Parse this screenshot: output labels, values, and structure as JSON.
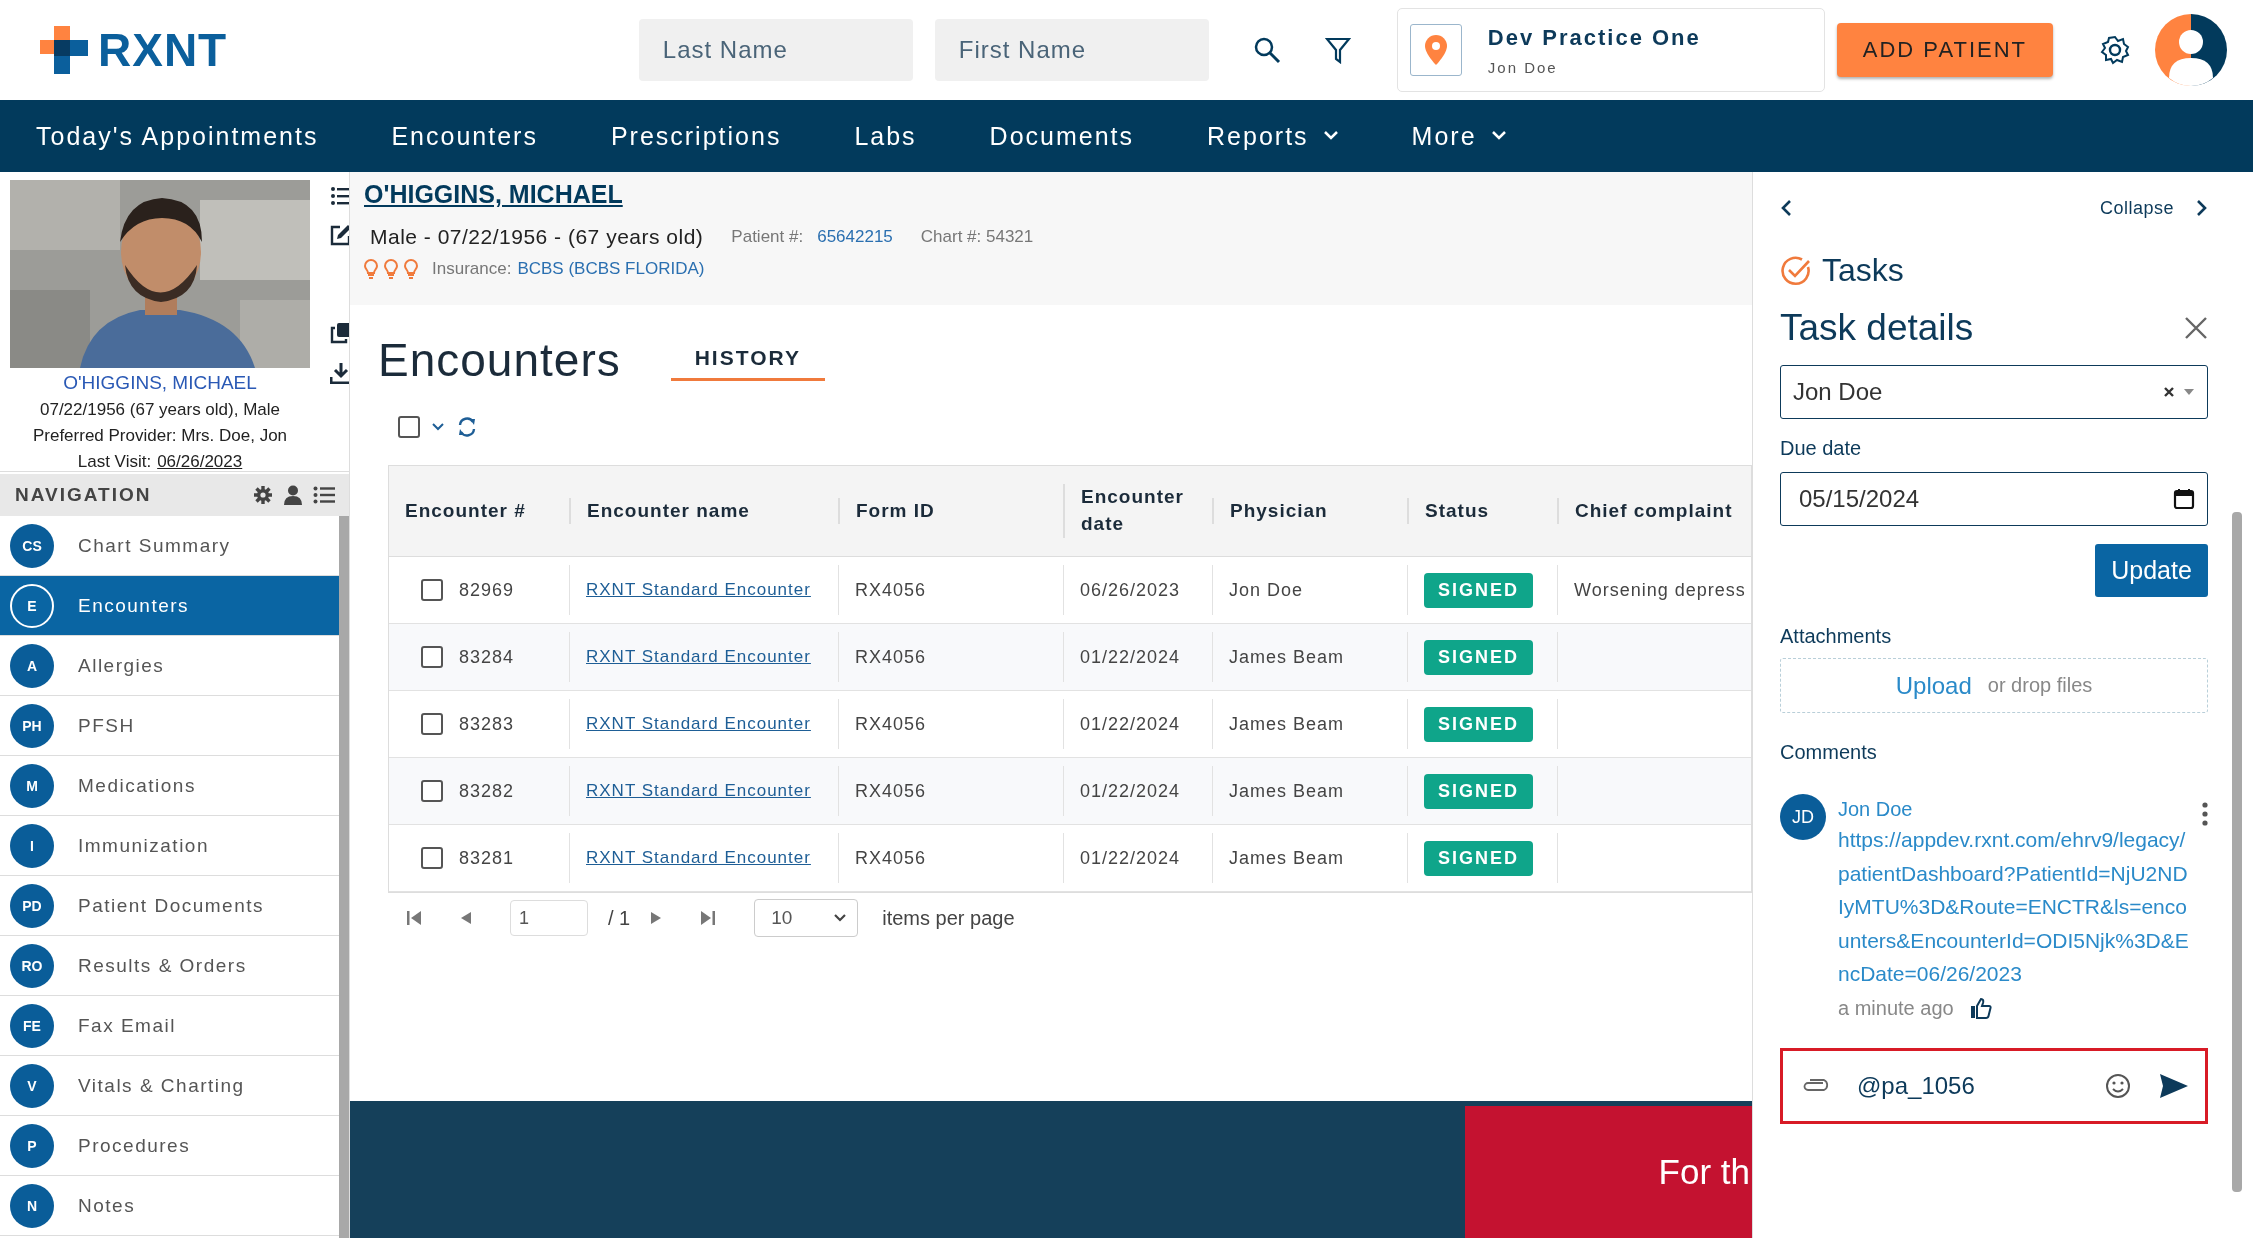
{
  "logo": {
    "text": "RXNT"
  },
  "search": {
    "last_name_placeholder": "Last Name",
    "first_name_placeholder": "First Name"
  },
  "practice": {
    "name": "Dev Practice One",
    "user": "Jon Doe"
  },
  "add_patient_button": "ADD PATIENT",
  "main_nav": [
    {
      "label": "Today's Appointments",
      "dropdown": false
    },
    {
      "label": "Encounters",
      "dropdown": false
    },
    {
      "label": "Prescriptions",
      "dropdown": false
    },
    {
      "label": "Labs",
      "dropdown": false
    },
    {
      "label": "Documents",
      "dropdown": false
    },
    {
      "label": "Reports",
      "dropdown": true
    },
    {
      "label": "More",
      "dropdown": true
    }
  ],
  "patient_card": {
    "name": "O'HIGGINS, MICHAEL",
    "details": "07/22/1956 (67 years old), Male",
    "provider": "Preferred Provider: Mrs. Doe, Jon",
    "last_visit_label": "Last Visit:",
    "last_visit": "06/26/2023"
  },
  "navigation": {
    "title": "NAVIGATION",
    "items": [
      {
        "abbr": "CS",
        "label": "Chart Summary",
        "selected": false
      },
      {
        "abbr": "E",
        "label": "Encounters",
        "selected": true
      },
      {
        "abbr": "A",
        "label": "Allergies",
        "selected": false
      },
      {
        "abbr": "PH",
        "label": "PFSH",
        "selected": false
      },
      {
        "abbr": "M",
        "label": "Medications",
        "selected": false
      },
      {
        "abbr": "I",
        "label": "Immunization",
        "selected": false
      },
      {
        "abbr": "PD",
        "label": "Patient Documents",
        "selected": false
      },
      {
        "abbr": "RO",
        "label": "Results & Orders",
        "selected": false
      },
      {
        "abbr": "FE",
        "label": "Fax Email",
        "selected": false
      },
      {
        "abbr": "V",
        "label": "Vitals & Charting",
        "selected": false
      },
      {
        "abbr": "P",
        "label": "Procedures",
        "selected": false
      },
      {
        "abbr": "N",
        "label": "Notes",
        "selected": false
      }
    ]
  },
  "patient_header": {
    "name": "O'HIGGINS, MICHAEL",
    "summary": "Male - 07/22/1956 - (67 years old)",
    "patient_no_label": "Patient #:",
    "patient_no": "65642215",
    "chart_no": "Chart #: 54321",
    "insurance_label": "Insurance:",
    "insurance": "BCBS (BCBS FLORIDA)"
  },
  "encounters": {
    "title": "Encounters",
    "tabs": [
      {
        "label": "HISTORY",
        "selected": true
      }
    ],
    "select_all": {
      "checked": false
    },
    "columns": [
      "Encounter #",
      "Encounter name",
      "Form ID",
      "Encounter date",
      "Physician",
      "Status",
      "Chief complaint"
    ],
    "rows": [
      {
        "checked": false,
        "number": "82969",
        "name": "RXNT Standard Encounter",
        "form_id": "RX4056",
        "date": "06/26/2023",
        "physician": "Jon Doe",
        "status": "SIGNED",
        "chief_complaint": "Worsening depress"
      },
      {
        "checked": false,
        "number": "83284",
        "name": "RXNT Standard Encounter",
        "form_id": "RX4056",
        "date": "01/22/2024",
        "physician": "James Beam",
        "status": "SIGNED"
      },
      {
        "checked": false,
        "number": "83283",
        "name": "RXNT Standard Encounter",
        "form_id": "RX4056",
        "date": "01/22/2024",
        "physician": "James Beam",
        "status": "SIGNED"
      },
      {
        "checked": false,
        "number": "83282",
        "name": "RXNT Standard Encounter",
        "form_id": "RX4056",
        "date": "01/22/2024",
        "physician": "James Beam",
        "status": "SIGNED"
      },
      {
        "checked": false,
        "number": "83281",
        "name": "RXNT Standard Encounter",
        "form_id": "RX4056",
        "date": "01/22/2024",
        "physician": "James Beam",
        "status": "SIGNED"
      }
    ],
    "pagination": {
      "page": "1",
      "total": "/ 1",
      "page_size": "10",
      "page_size_label": "items per page"
    }
  },
  "banner": {
    "text": "For th"
  },
  "task_panel": {
    "collapse": "Collapse",
    "title": "Tasks",
    "details_title": "Task details",
    "assignee": "Jon Doe",
    "due_date_label": "Due date",
    "due_date": "05/15/2024",
    "update_button": "Update",
    "attachments_label": "Attachments",
    "upload_link": "Upload",
    "drop_hint": "or drop files",
    "comments_label": "Comments",
    "comments": [
      {
        "initials": "JD",
        "author": "Jon Doe",
        "text": "https://appdev.rxnt.com/ehrv9/legacy/patientDashboard?PatientId=NjU2NDIyMTU%3D&Route=ENCTR&ls=encounters&EncounterId=ODI5Njk%3D&EncDate=06/26/2023",
        "time": "a minute ago"
      }
    ],
    "comment_input": "@pa_1056"
  }
}
